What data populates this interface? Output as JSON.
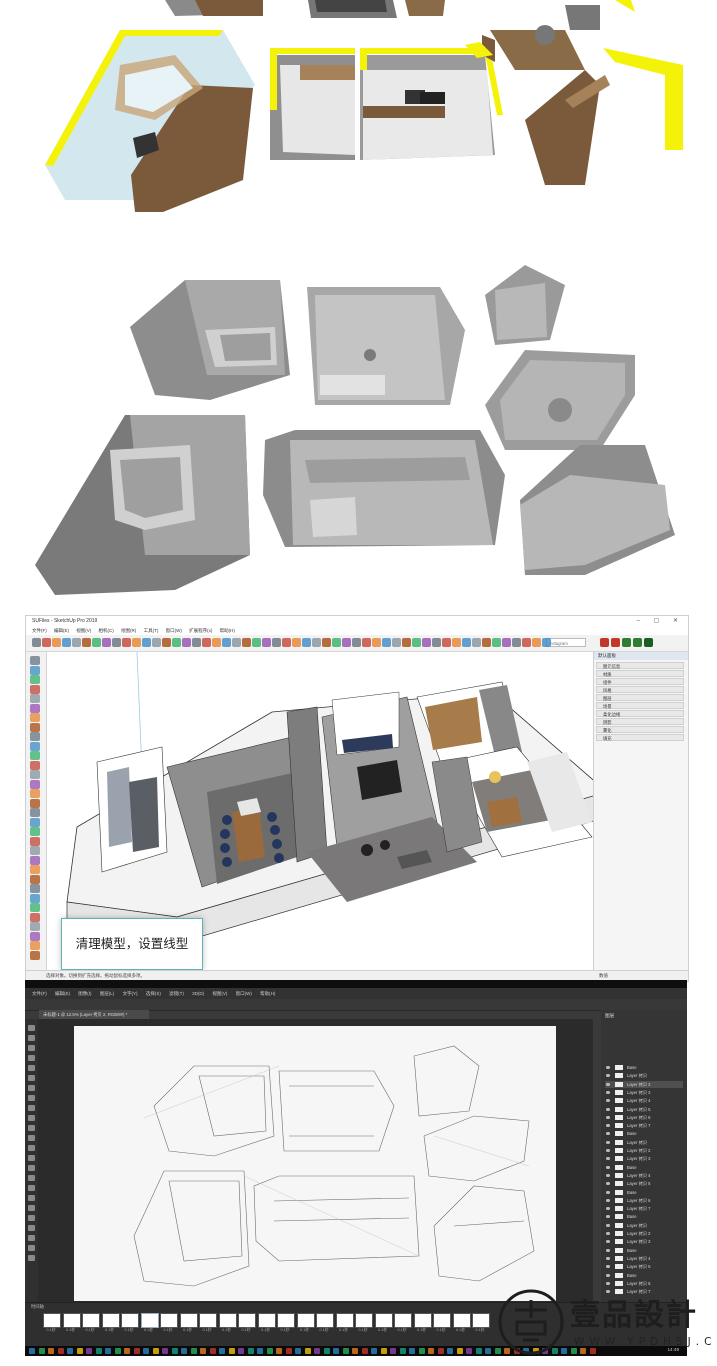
{
  "sketchup": {
    "window_title": "SUFiles - SketchUp Pro 2019",
    "menu": [
      "文件(F)",
      "编辑(E)",
      "视图(V)",
      "相机(C)",
      "绘图(R)",
      "工具(T)",
      "窗口(W)",
      "扩展程序(x)",
      "帮助(H)"
    ],
    "search_placeholder": "instagram",
    "caption": "清理模型，设置线型",
    "status_left": "选择对象。切换到扩充选择。拖动鼠标选择多项。",
    "status_right": "数值",
    "tray_title": "默认面板",
    "tray_items": [
      "图元信息",
      "材质",
      "组件",
      "风格",
      "图层",
      "场景",
      "柔化边线",
      "阴影",
      "雾化",
      "填充"
    ]
  },
  "photoshop": {
    "menu": [
      "文件(F)",
      "编辑(E)",
      "图像(I)",
      "图层(L)",
      "文字(Y)",
      "选择(S)",
      "滤镜(T)",
      "3D(D)",
      "视图(V)",
      "窗口(W)",
      "帮助(H)"
    ],
    "doc_tab": "未标题-1 @ 12.5% (Layer 拷贝 2, RGB/8#) *",
    "zoom": "12.5%",
    "timeline_label": "时间轴",
    "layers_title": "图层",
    "layers": [
      "Base",
      "Layer 拷贝",
      "Layer 拷贝 2",
      "Layer 拷贝 3",
      "Layer 拷贝 4",
      "Layer 拷贝 5",
      "Layer 拷贝 6",
      "Layer 拷贝 7",
      "Base",
      "Layer 拷贝",
      "Layer 拷贝 2",
      "Layer 拷贝 3",
      "Base",
      "Layer 拷贝 4",
      "Layer 拷贝 5",
      "Base",
      "Layer 拷贝 6",
      "Layer 拷贝 7",
      "Base",
      "Layer 拷贝",
      "Layer 拷贝 2",
      "Layer 拷贝 3",
      "Base",
      "Layer 拷贝 4",
      "Layer 拷贝 5",
      "Base",
      "Layer 拷贝 6",
      "Layer 拷贝 7"
    ],
    "frame_label": "0.1秒",
    "clock": "14:49"
  },
  "logo": {
    "name": "壹品設計",
    "url": "WWW.YPDHSJ.COM"
  },
  "colors": {
    "yellow_highlight": "#f5f20a",
    "model_gray": "#8a8a8a",
    "wood": "#7a5a3a",
    "caption_border": "#62b0b8"
  }
}
